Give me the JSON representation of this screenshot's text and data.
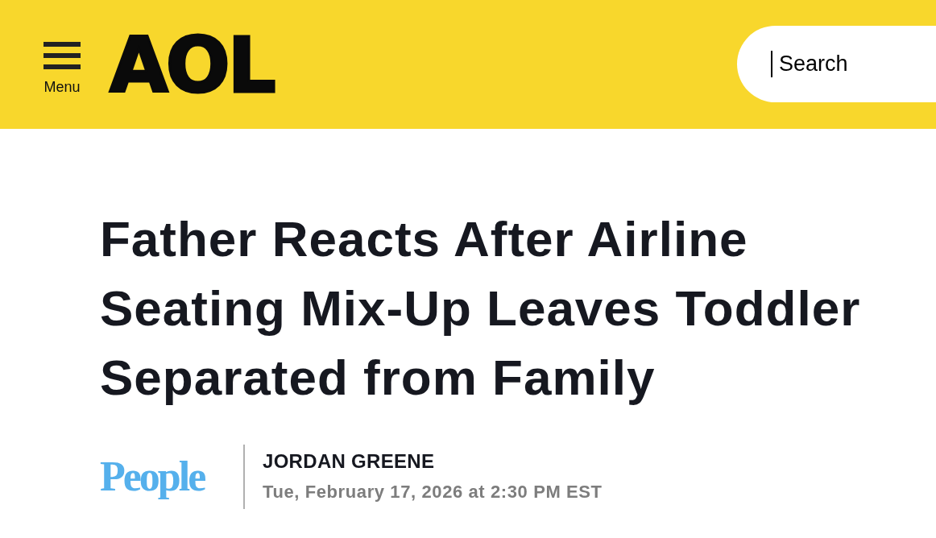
{
  "header": {
    "menu": {
      "label": "Menu"
    },
    "logo": {
      "text": "AOL"
    },
    "search": {
      "placeholder": "Search",
      "focused": true
    }
  },
  "article": {
    "headline": "Father Reacts After Airline Seating Mix-Up Leaves Toddler Separated from Family",
    "source": {
      "logo_text": "People"
    },
    "author": "JORDAN GREENE",
    "date": "Tue, February 17, 2026 at 2:30 PM EST"
  }
}
